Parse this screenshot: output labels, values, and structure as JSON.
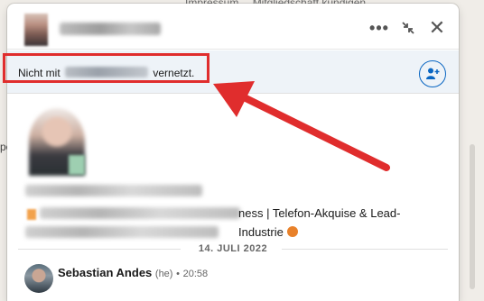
{
  "background": {
    "footer_links": [
      "Impressum",
      "Mitgliedschaft kündigen"
    ],
    "left_fragment": "pe"
  },
  "chat": {
    "header": {
      "more_label": "•••",
      "close_label": "✕"
    },
    "connection_banner": {
      "text_before": "Nicht mit",
      "text_after": "vernetzt."
    },
    "profile": {
      "headline_visible": "ness | Telefon-Akquise & Lead-",
      "headline_line2": "Industrie"
    },
    "date_separator": "14. JULI 2022",
    "message": {
      "sender": "Sebastian Andes",
      "pronouns": "(he)",
      "time": "20:58"
    }
  },
  "colors": {
    "accent_blue": "#0a66c2",
    "annotation_red": "#e02d2d",
    "banner_bg": "#eef3f8"
  },
  "icons": [
    "more-options-icon",
    "minimize-icon",
    "close-icon",
    "add-connection-icon"
  ]
}
